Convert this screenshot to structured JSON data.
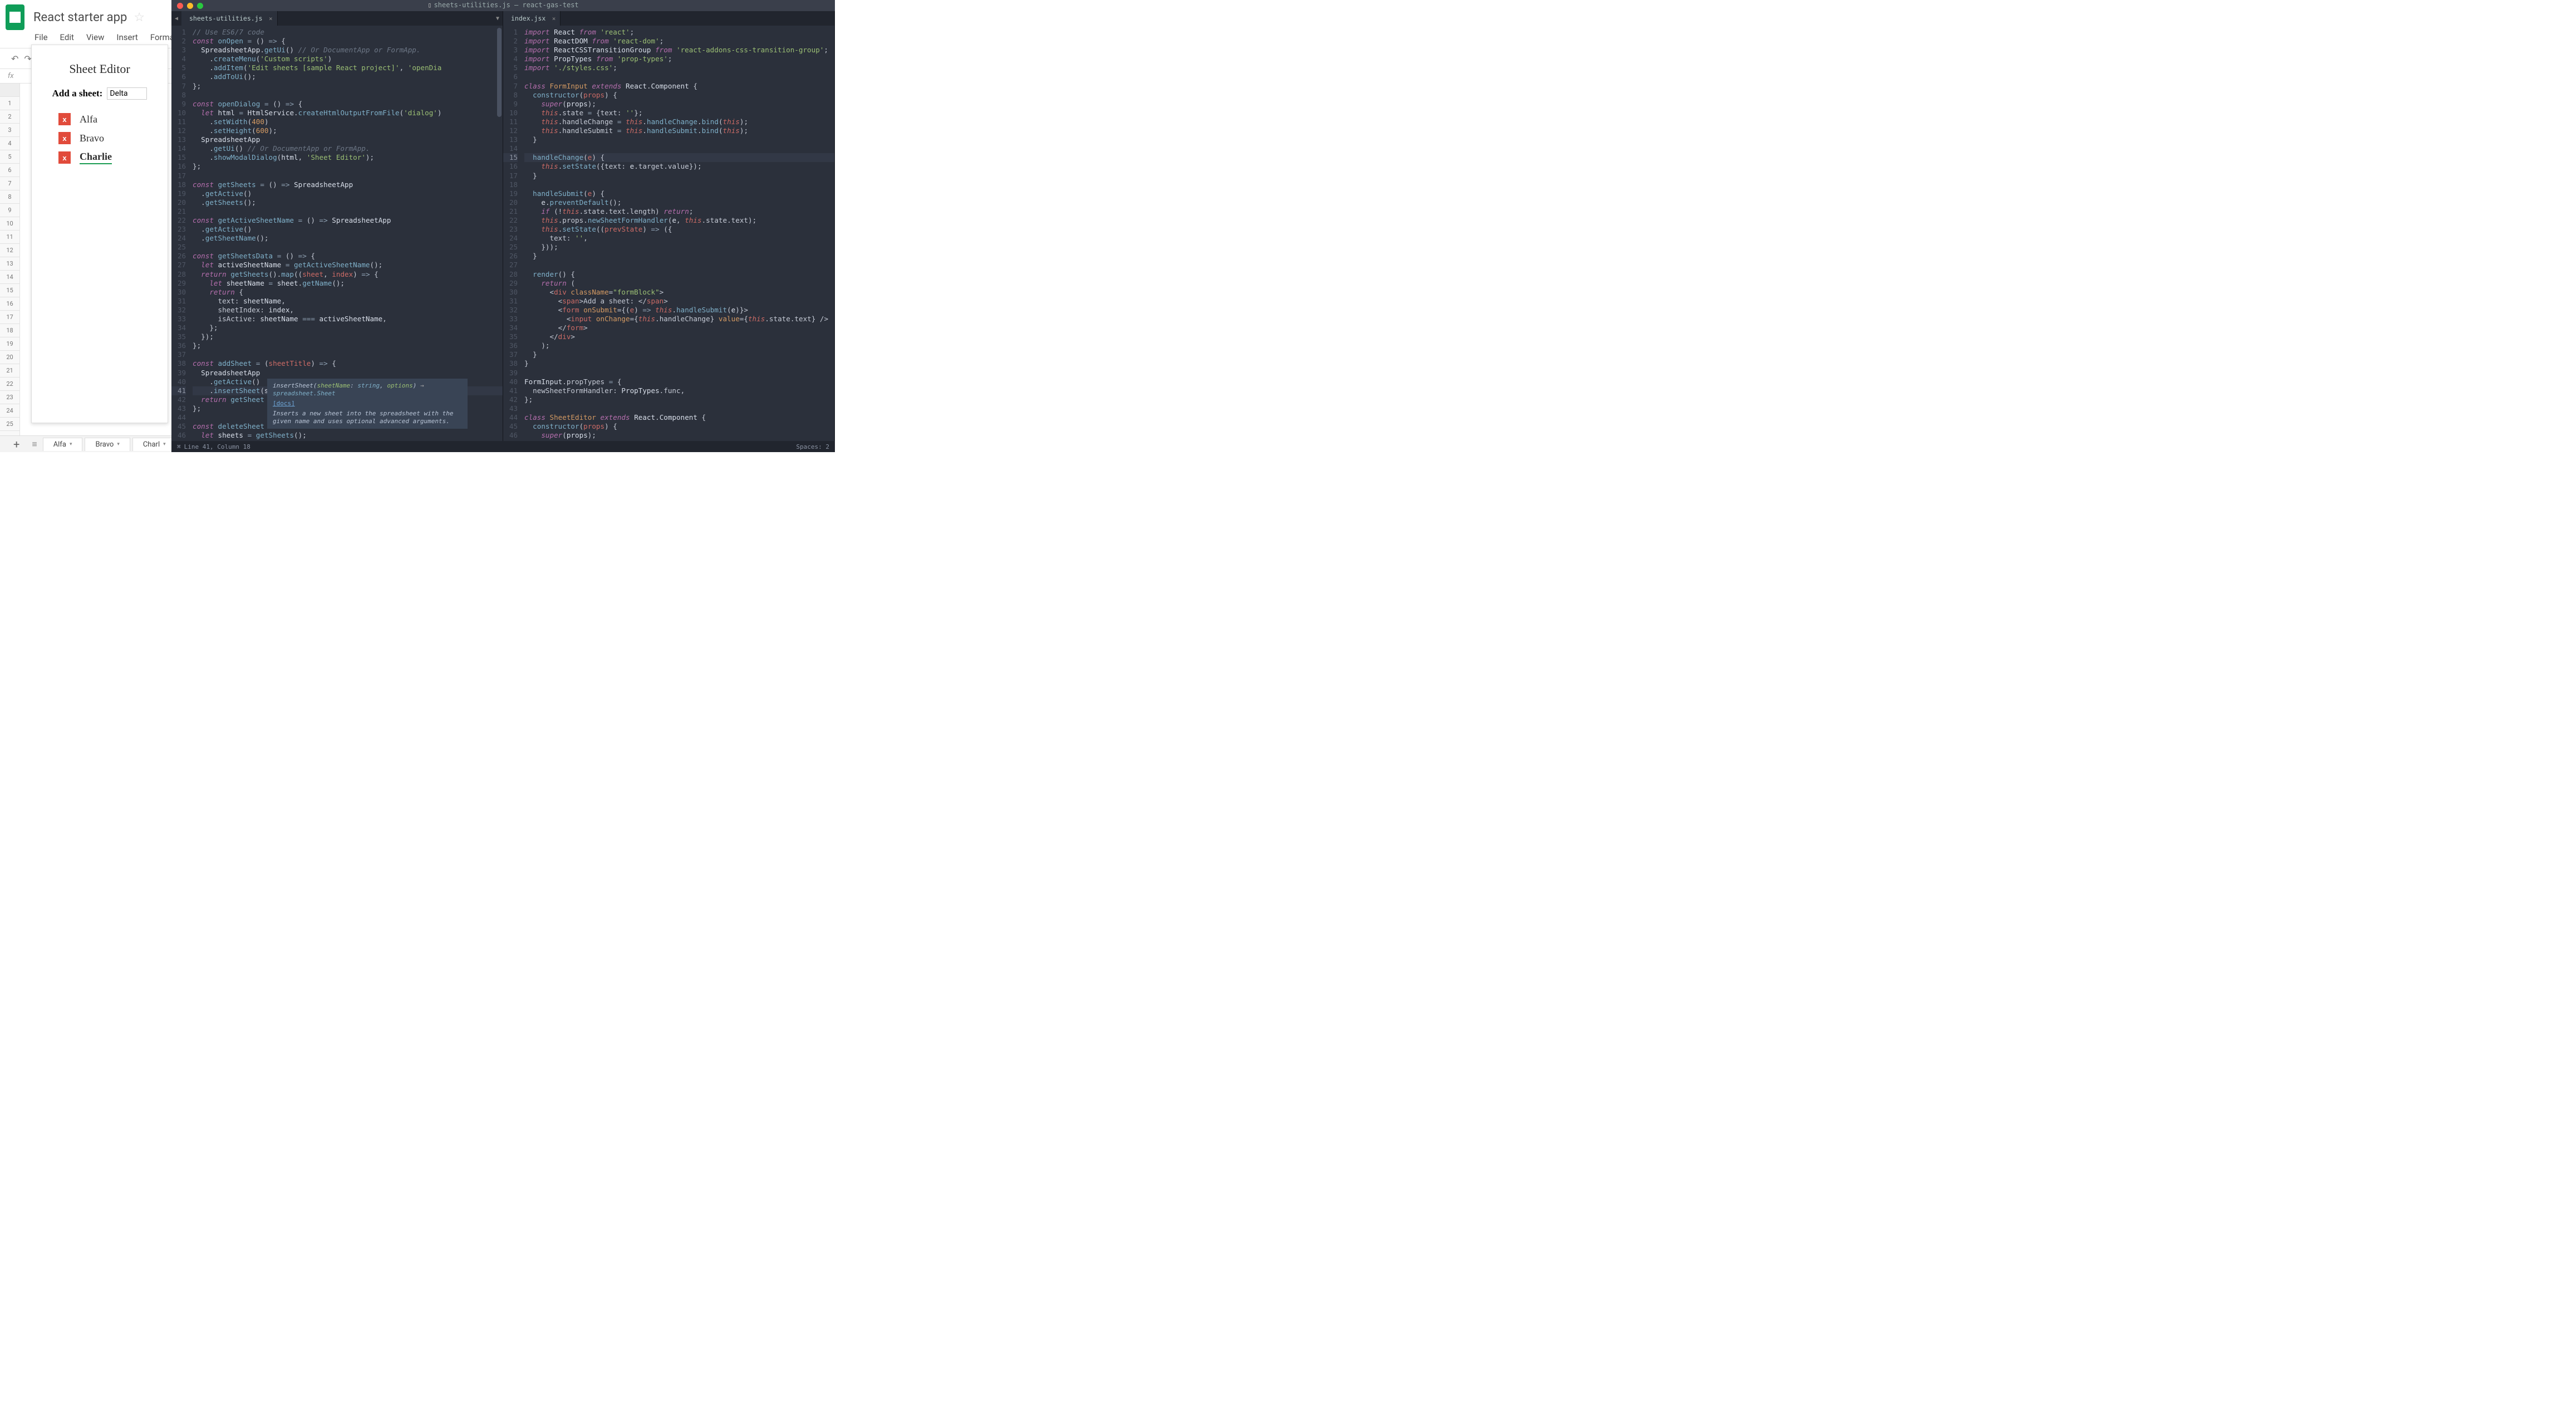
{
  "sheets": {
    "title": "React starter app",
    "menu": [
      "File",
      "Edit",
      "View",
      "Insert",
      "Forma"
    ],
    "fx_label": "fx",
    "row_numbers": [
      "",
      "1",
      "2",
      "3",
      "4",
      "5",
      "6",
      "7",
      "8",
      "9",
      "10",
      "11",
      "12",
      "13",
      "14",
      "15",
      "16",
      "17",
      "18",
      "19",
      "20",
      "21",
      "22",
      "23",
      "24",
      "25"
    ],
    "tabs": [
      {
        "label": "Alfa",
        "active": false
      },
      {
        "label": "Bravo",
        "active": false
      },
      {
        "label": "Charl",
        "active": true
      }
    ],
    "plus_glyph": "+",
    "menu_glyph": "≡"
  },
  "dialog": {
    "title": "Sheet Editor",
    "add_label": "Add a sheet:",
    "input_value": "Delta",
    "items": [
      {
        "label": "Alfa",
        "active": false
      },
      {
        "label": "Bravo",
        "active": false
      },
      {
        "label": "Charlie",
        "active": true
      }
    ],
    "x_glyph": "x"
  },
  "editor": {
    "window_title": "sheets-utilities.js — react-gas-test",
    "window_icon": "▯",
    "tabs_left": [
      {
        "label": "sheets-utilities.js"
      }
    ],
    "tabs_right": [
      {
        "label": "index.jsx"
      }
    ],
    "status_left": "Line 41, Column 18",
    "status_right": "Spaces: 2",
    "arrow_left": "◀",
    "arrow_down": "▼",
    "tooltip": {
      "sig_pre": "insertSheet(",
      "sig_p1": "sheetName",
      "sig_c1": ": ",
      "sig_t1": "string",
      "sig_c2": ", ",
      "sig_p2": "options",
      "sig_post": ") ",
      "sig_arrow": "→",
      "sig_ret": " spreadsheet.Sheet",
      "docs_label": "[docs]",
      "desc": "Inserts a new sheet into the spreadsheet with the given name and uses optional advanced arguments."
    },
    "left_highlight_line": 41,
    "right_highlight_line": 15,
    "left_code": [
      {
        "n": 1,
        "h": "<span class=c-cm>// Use ES6/7 code</span>"
      },
      {
        "n": 2,
        "h": "<span class=c-kw>const</span> <span class=c-fn>onOpen</span> <span class=c-op>=</span> () <span class=c-op>=&gt;</span> {"
      },
      {
        "n": 3,
        "h": "  <span class=c-id>SpreadsheetApp</span>.<span class=c-fn>getUi</span>() <span class=c-cm>// Or DocumentApp or FormApp.</span>"
      },
      {
        "n": 4,
        "h": "    .<span class=c-fn>createMenu</span>(<span class=c-str>'Custom scripts'</span>)"
      },
      {
        "n": 5,
        "h": "    .<span class=c-fn>addItem</span>(<span class=c-str>'Edit sheets [sample React project]'</span>, <span class=c-str>'openDia</span>"
      },
      {
        "n": 6,
        "h": "    .<span class=c-fn>addToUi</span>();"
      },
      {
        "n": 7,
        "h": "};"
      },
      {
        "n": 8,
        "h": ""
      },
      {
        "n": 9,
        "h": "<span class=c-kw>const</span> <span class=c-fn>openDialog</span> <span class=c-op>=</span> () <span class=c-op>=&gt;</span> {"
      },
      {
        "n": 10,
        "h": "  <span class=c-kw>let</span> <span class=c-id>html</span> <span class=c-op>=</span> <span class=c-id>HtmlService</span>.<span class=c-fn>createHtmlOutputFromFile</span>(<span class=c-str>'dialog'</span>)"
      },
      {
        "n": 11,
        "h": "    .<span class=c-fn>setWidth</span>(<span class=c-num>400</span>)"
      },
      {
        "n": 12,
        "h": "    .<span class=c-fn>setHeight</span>(<span class=c-num>600</span>);"
      },
      {
        "n": 13,
        "h": "  <span class=c-id>SpreadsheetApp</span>"
      },
      {
        "n": 14,
        "h": "    .<span class=c-fn>getUi</span>() <span class=c-cm>// Or DocumentApp or FormApp.</span>"
      },
      {
        "n": 15,
        "h": "    .<span class=c-fn>showModalDialog</span>(<span class=c-id>html</span>, <span class=c-str>'Sheet Editor'</span>);"
      },
      {
        "n": 16,
        "h": "};"
      },
      {
        "n": 17,
        "h": ""
      },
      {
        "n": 18,
        "h": "<span class=c-kw>const</span> <span class=c-fn>getSheets</span> <span class=c-op>=</span> () <span class=c-op>=&gt;</span> <span class=c-id>SpreadsheetApp</span>"
      },
      {
        "n": 19,
        "h": "  .<span class=c-fn>getActive</span>()"
      },
      {
        "n": 20,
        "h": "  .<span class=c-fn>getSheets</span>();"
      },
      {
        "n": 21,
        "h": ""
      },
      {
        "n": 22,
        "h": "<span class=c-kw>const</span> <span class=c-fn>getActiveSheetName</span> <span class=c-op>=</span> () <span class=c-op>=&gt;</span> <span class=c-id>SpreadsheetApp</span>"
      },
      {
        "n": 23,
        "h": "  .<span class=c-fn>getActive</span>()"
      },
      {
        "n": 24,
        "h": "  .<span class=c-fn>getSheetName</span>();"
      },
      {
        "n": 25,
        "h": ""
      },
      {
        "n": 26,
        "h": "<span class=c-kw>const</span> <span class=c-fn>getSheetsData</span> <span class=c-op>=</span> () <span class=c-op>=&gt;</span> {"
      },
      {
        "n": 27,
        "h": "  <span class=c-kw>let</span> <span class=c-id>activeSheetName</span> <span class=c-op>=</span> <span class=c-fn>getActiveSheetName</span>();"
      },
      {
        "n": 28,
        "h": "  <span class=c-kw>return</span> <span class=c-fn>getSheets</span>().<span class=c-fn>map</span>((<span class=c-var>sheet</span>, <span class=c-var>index</span>) <span class=c-op>=&gt;</span> {"
      },
      {
        "n": 29,
        "h": "    <span class=c-kw>let</span> <span class=c-id>sheetName</span> <span class=c-op>=</span> <span class=c-id>sheet</span>.<span class=c-fn>getName</span>();"
      },
      {
        "n": 30,
        "h": "    <span class=c-kw>return</span> {"
      },
      {
        "n": 31,
        "h": "      <span class=c-prop>text</span>: <span class=c-id>sheetName</span>,"
      },
      {
        "n": 32,
        "h": "      <span class=c-prop>sheetIndex</span>: <span class=c-id>index</span>,"
      },
      {
        "n": 33,
        "h": "      <span class=c-prop>isActive</span>: <span class=c-id>sheetName</span> <span class=c-op>===</span> <span class=c-id>activeSheetName</span>,"
      },
      {
        "n": 34,
        "h": "    };"
      },
      {
        "n": 35,
        "h": "  });"
      },
      {
        "n": 36,
        "h": "};"
      },
      {
        "n": 37,
        "h": ""
      },
      {
        "n": 38,
        "h": "<span class=c-kw>const</span> <span class=c-fn>addSheet</span> <span class=c-op>=</span> (<span class=c-var>sheetTitle</span>) <span class=c-op>=&gt;</span> {"
      },
      {
        "n": 39,
        "h": "  <span class=c-id>SpreadsheetApp</span>"
      },
      {
        "n": 40,
        "h": "    .<span class=c-fn>getActive</span>()"
      },
      {
        "n": 41,
        "h": "    .<span class=c-fn>insertSheet</span>(<span class=c-id>sheetTitle</span>);"
      },
      {
        "n": 42,
        "h": "  <span class=c-kw>return</span> <span class=c-fn>getSheet</span>"
      },
      {
        "n": 43,
        "h": "};"
      },
      {
        "n": 44,
        "h": ""
      },
      {
        "n": 45,
        "h": "<span class=c-kw>const</span> <span class=c-fn>deleteSheet</span>"
      },
      {
        "n": 46,
        "h": "  <span class=c-kw>let</span> <span class=c-id>sheets</span> <span class=c-op>=</span> <span class=c-fn>getSheets</span>();"
      }
    ],
    "right_code": [
      {
        "n": 1,
        "h": "<span class=c-kw>import</span> <span class=c-id>React</span> <span class=c-kw>from</span> <span class=c-str>'react'</span>;"
      },
      {
        "n": 2,
        "h": "<span class=c-kw>import</span> <span class=c-id>ReactDOM</span> <span class=c-kw>from</span> <span class=c-str>'react-dom'</span>;"
      },
      {
        "n": 3,
        "h": "<span class=c-kw>import</span> <span class=c-id>ReactCSSTransitionGroup</span> <span class=c-kw>from</span> <span class=c-str>'react-addons-css-transition-group'</span>;"
      },
      {
        "n": 4,
        "h": "<span class=c-kw>import</span> <span class=c-id>PropTypes</span> <span class=c-kw>from</span> <span class=c-str>'prop-types'</span>;"
      },
      {
        "n": 5,
        "h": "<span class=c-kw>import</span> <span class=c-str>'./styles.css'</span>;"
      },
      {
        "n": 6,
        "h": ""
      },
      {
        "n": 7,
        "h": "<span class=c-kw>class</span> <span class=c-const>FormInput</span> <span class=c-kw>extends</span> <span class=c-id>React</span>.<span class=c-id>Component</span> {"
      },
      {
        "n": 8,
        "h": "  <span class=c-fn>constructor</span>(<span class=c-var>props</span>) {"
      },
      {
        "n": 9,
        "h": "    <span class=c-kw>super</span>(<span class=c-id>props</span>);"
      },
      {
        "n": 10,
        "h": "    <span class=c-self>this</span>.<span class=c-prop>state</span> <span class=c-op>=</span> {<span class=c-prop>text</span>: <span class=c-str>''</span>};"
      },
      {
        "n": 11,
        "h": "    <span class=c-self>this</span>.<span class=c-prop>handleChange</span> <span class=c-op>=</span> <span class=c-self>this</span>.<span class=c-fn>handleChange</span>.<span class=c-fn>bind</span>(<span class=c-self>this</span>);"
      },
      {
        "n": 12,
        "h": "    <span class=c-self>this</span>.<span class=c-prop>handleSubmit</span> <span class=c-op>=</span> <span class=c-self>this</span>.<span class=c-fn>handleSubmit</span>.<span class=c-fn>bind</span>(<span class=c-self>this</span>);"
      },
      {
        "n": 13,
        "h": "  }"
      },
      {
        "n": 14,
        "h": ""
      },
      {
        "n": 15,
        "h": "  <span class=c-fn>handleChange</span>(<span class=c-var>e</span>) {"
      },
      {
        "n": 16,
        "h": "    <span class=c-self>this</span>.<span class=c-fn>setState</span>({<span class=c-prop>text</span>: <span class=c-id>e</span>.<span class=c-prop>target</span>.<span class=c-prop>value</span>});"
      },
      {
        "n": 17,
        "h": "  }"
      },
      {
        "n": 18,
        "h": ""
      },
      {
        "n": 19,
        "h": "  <span class=c-fn>handleSubmit</span>(<span class=c-var>e</span>) {"
      },
      {
        "n": 20,
        "h": "    <span class=c-id>e</span>.<span class=c-fn>preventDefault</span>();"
      },
      {
        "n": 21,
        "h": "    <span class=c-kw>if</span> (!<span class=c-self>this</span>.<span class=c-prop>state</span>.<span class=c-prop>text</span>.<span class=c-prop>length</span>) <span class=c-kw>return</span>;"
      },
      {
        "n": 22,
        "h": "    <span class=c-self>this</span>.<span class=c-prop>props</span>.<span class=c-fn>newSheetFormHandler</span>(<span class=c-id>e</span>, <span class=c-self>this</span>.<span class=c-prop>state</span>.<span class=c-prop>text</span>);"
      },
      {
        "n": 23,
        "h": "    <span class=c-self>this</span>.<span class=c-fn>setState</span>((<span class=c-var>prevState</span>) <span class=c-op>=&gt;</span> ({"
      },
      {
        "n": 24,
        "h": "      <span class=c-prop>text</span>: <span class=c-str>''</span>,"
      },
      {
        "n": 25,
        "h": "    }));"
      },
      {
        "n": 26,
        "h": "  }"
      },
      {
        "n": 27,
        "h": ""
      },
      {
        "n": 28,
        "h": "  <span class=c-fn>render</span>() {"
      },
      {
        "n": 29,
        "h": "    <span class=c-kw>return</span> ("
      },
      {
        "n": 30,
        "h": "      &lt;<span class=c-tag>div</span> <span class=c-attr>className</span>=<span class=c-str>\"formBlock\"</span>&gt;"
      },
      {
        "n": 31,
        "h": "        &lt;<span class=c-tag>span</span>&gt;Add a sheet: &lt;/<span class=c-tag>span</span>&gt;"
      },
      {
        "n": 32,
        "h": "        &lt;<span class=c-tag>form</span> <span class=c-attr>onSubmit</span>={(<span class=c-var>e</span>) <span class=c-op>=&gt;</span> <span class=c-self>this</span>.<span class=c-fn>handleSubmit</span>(<span class=c-id>e</span>)}&gt;"
      },
      {
        "n": 33,
        "h": "          &lt;<span class=c-tag>input</span> <span class=c-attr>onChange</span>={<span class=c-self>this</span>.<span class=c-prop>handleChange</span>} <span class=c-attr>value</span>={<span class=c-self>this</span>.<span class=c-prop>state</span>.<span class=c-prop>text</span>} /&gt;"
      },
      {
        "n": 34,
        "h": "        &lt;/<span class=c-tag>form</span>&gt;"
      },
      {
        "n": 35,
        "h": "      &lt;/<span class=c-tag>div</span>&gt;"
      },
      {
        "n": 36,
        "h": "    );"
      },
      {
        "n": 37,
        "h": "  }"
      },
      {
        "n": 38,
        "h": "}"
      },
      {
        "n": 39,
        "h": ""
      },
      {
        "n": 40,
        "h": "<span class=c-id>FormInput</span>.<span class=c-prop>propTypes</span> <span class=c-op>=</span> {"
      },
      {
        "n": 41,
        "h": "  <span class=c-prop>newSheetFormHandler</span>: <span class=c-id>PropTypes</span>.<span class=c-prop>func</span>,"
      },
      {
        "n": 42,
        "h": "};"
      },
      {
        "n": 43,
        "h": ""
      },
      {
        "n": 44,
        "h": "<span class=c-kw>class</span> <span class=c-const>SheetEditor</span> <span class=c-kw>extends</span> <span class=c-id>React</span>.<span class=c-id>Component</span> {"
      },
      {
        "n": 45,
        "h": "  <span class=c-fn>constructor</span>(<span class=c-var>props</span>) {"
      },
      {
        "n": 46,
        "h": "    <span class=c-kw>super</span>(<span class=c-id>props</span>);"
      }
    ]
  }
}
